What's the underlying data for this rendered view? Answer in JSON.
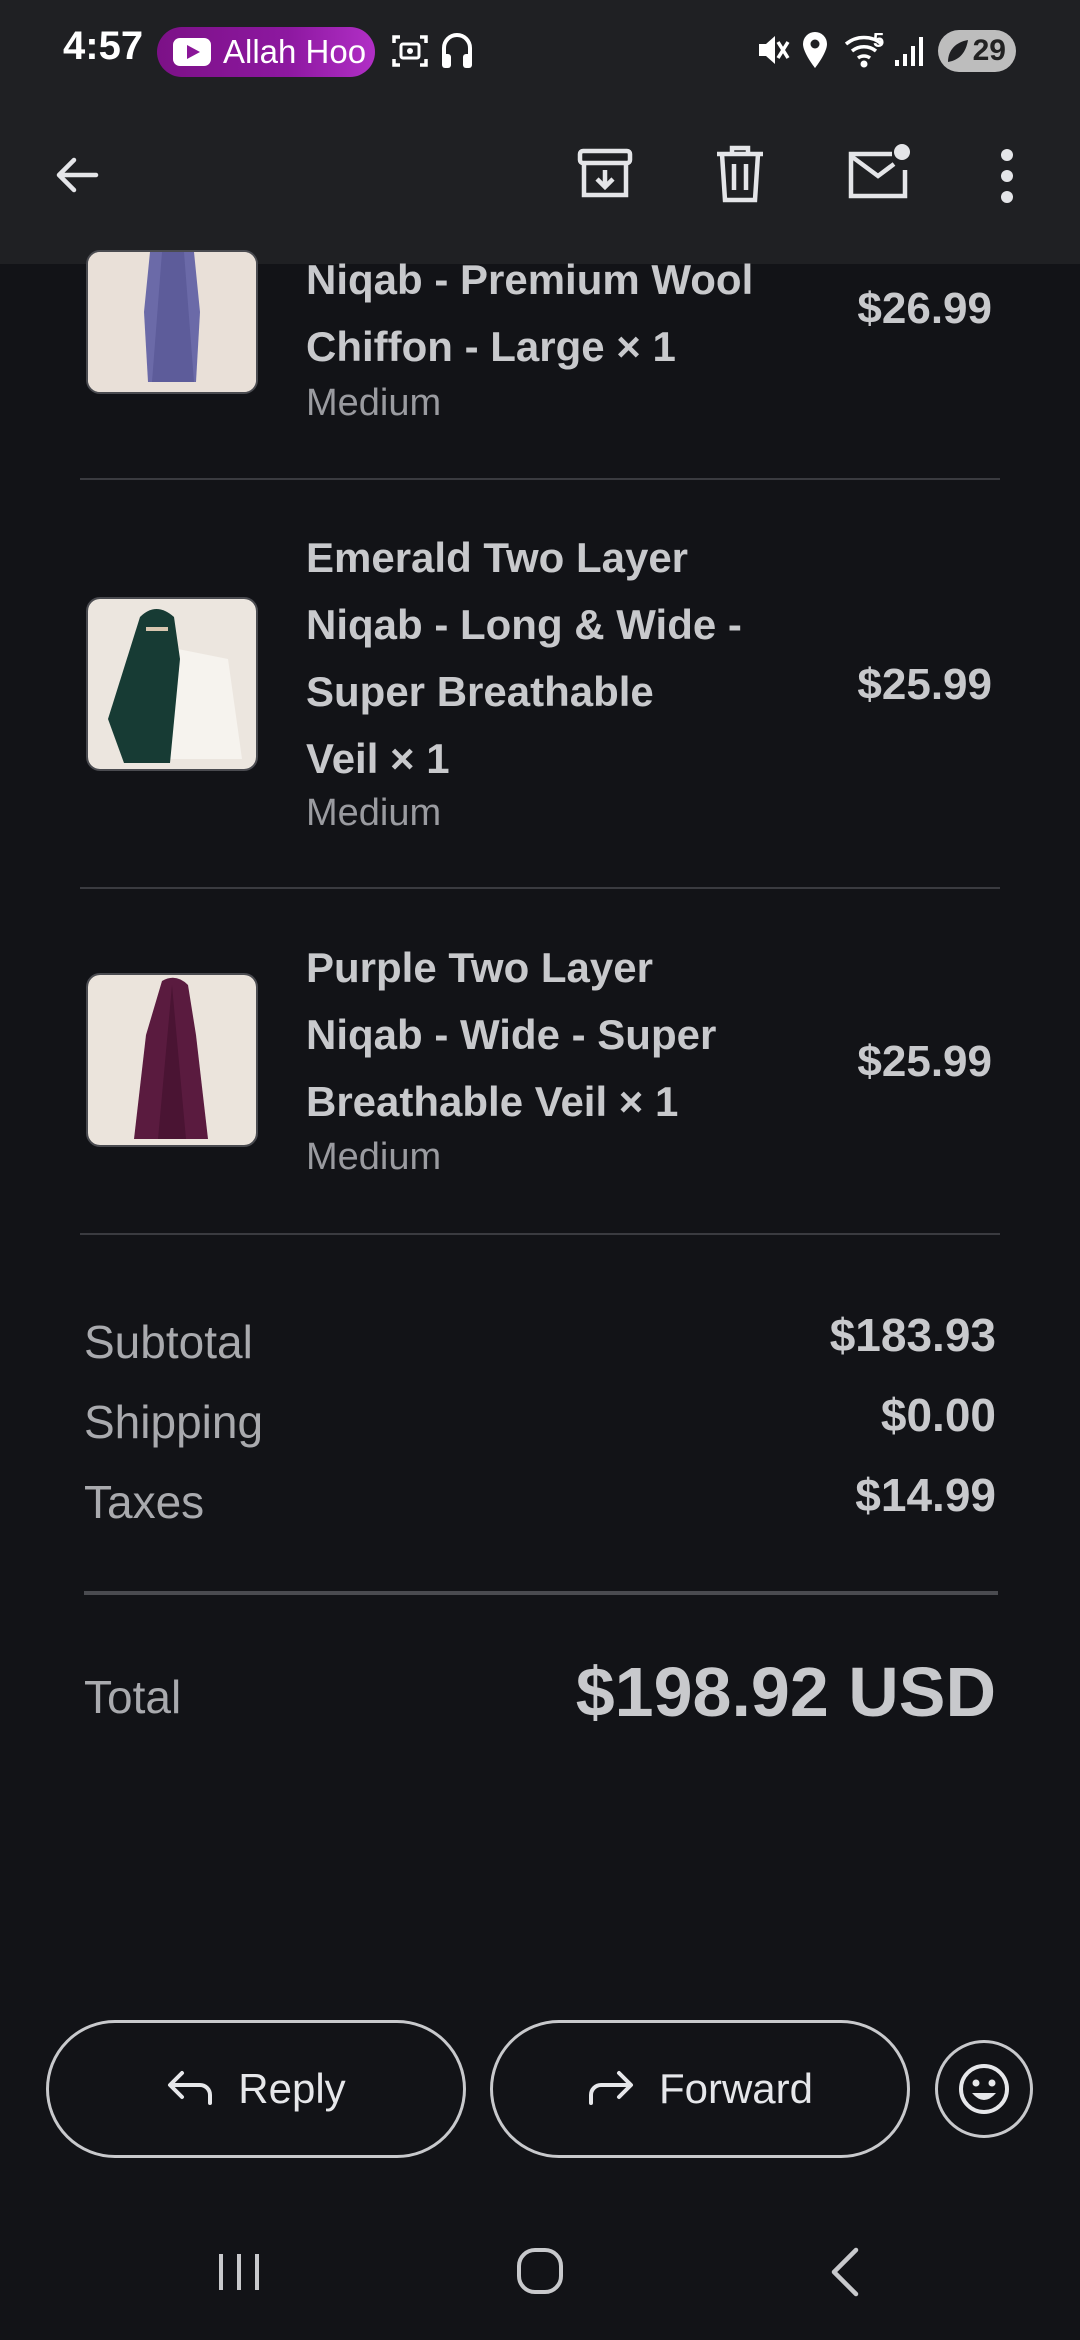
{
  "status_bar": {
    "time": "4:57",
    "notification_text": "Allah Hoo",
    "wifi_badge": "5",
    "battery": "29"
  },
  "app_bar": {
    "icons": [
      "back-arrow-icon",
      "archive-icon",
      "delete-icon",
      "mark-unread-icon",
      "more-vert-icon"
    ]
  },
  "items": [
    {
      "title_lines": [
        "Niqab - Premium Wool",
        "Chiffon - Large × 1"
      ],
      "variant": "Medium",
      "price": "$26.99",
      "thumb_color": "#6b6aa8"
    },
    {
      "title_lines": [
        "Emerald Two Layer",
        "Niqab - Long & Wide -",
        "Super Breathable",
        "Veil × 1"
      ],
      "variant": "Medium",
      "price": "$25.99",
      "thumb_color": "#173b34"
    },
    {
      "title_lines": [
        "Purple Two Layer",
        "Niqab - Wide - Super",
        "Breathable Veil × 1"
      ],
      "variant": "Medium",
      "price": "$25.99",
      "thumb_color": "#5a1b3f"
    }
  ],
  "summary": {
    "subtotal_label": "Subtotal",
    "subtotal_value": "$183.93",
    "shipping_label": "Shipping",
    "shipping_value": "$0.00",
    "taxes_label": "Taxes",
    "taxes_value": "$14.99",
    "total_label": "Total",
    "total_value": "$198.92 USD"
  },
  "actions": {
    "reply_label": "Reply",
    "forward_label": "Forward"
  },
  "colors": {
    "background": "#121317",
    "bar": "#1f2023",
    "text": "#c8c9cc",
    "notification_pill": "#8d18a0"
  }
}
